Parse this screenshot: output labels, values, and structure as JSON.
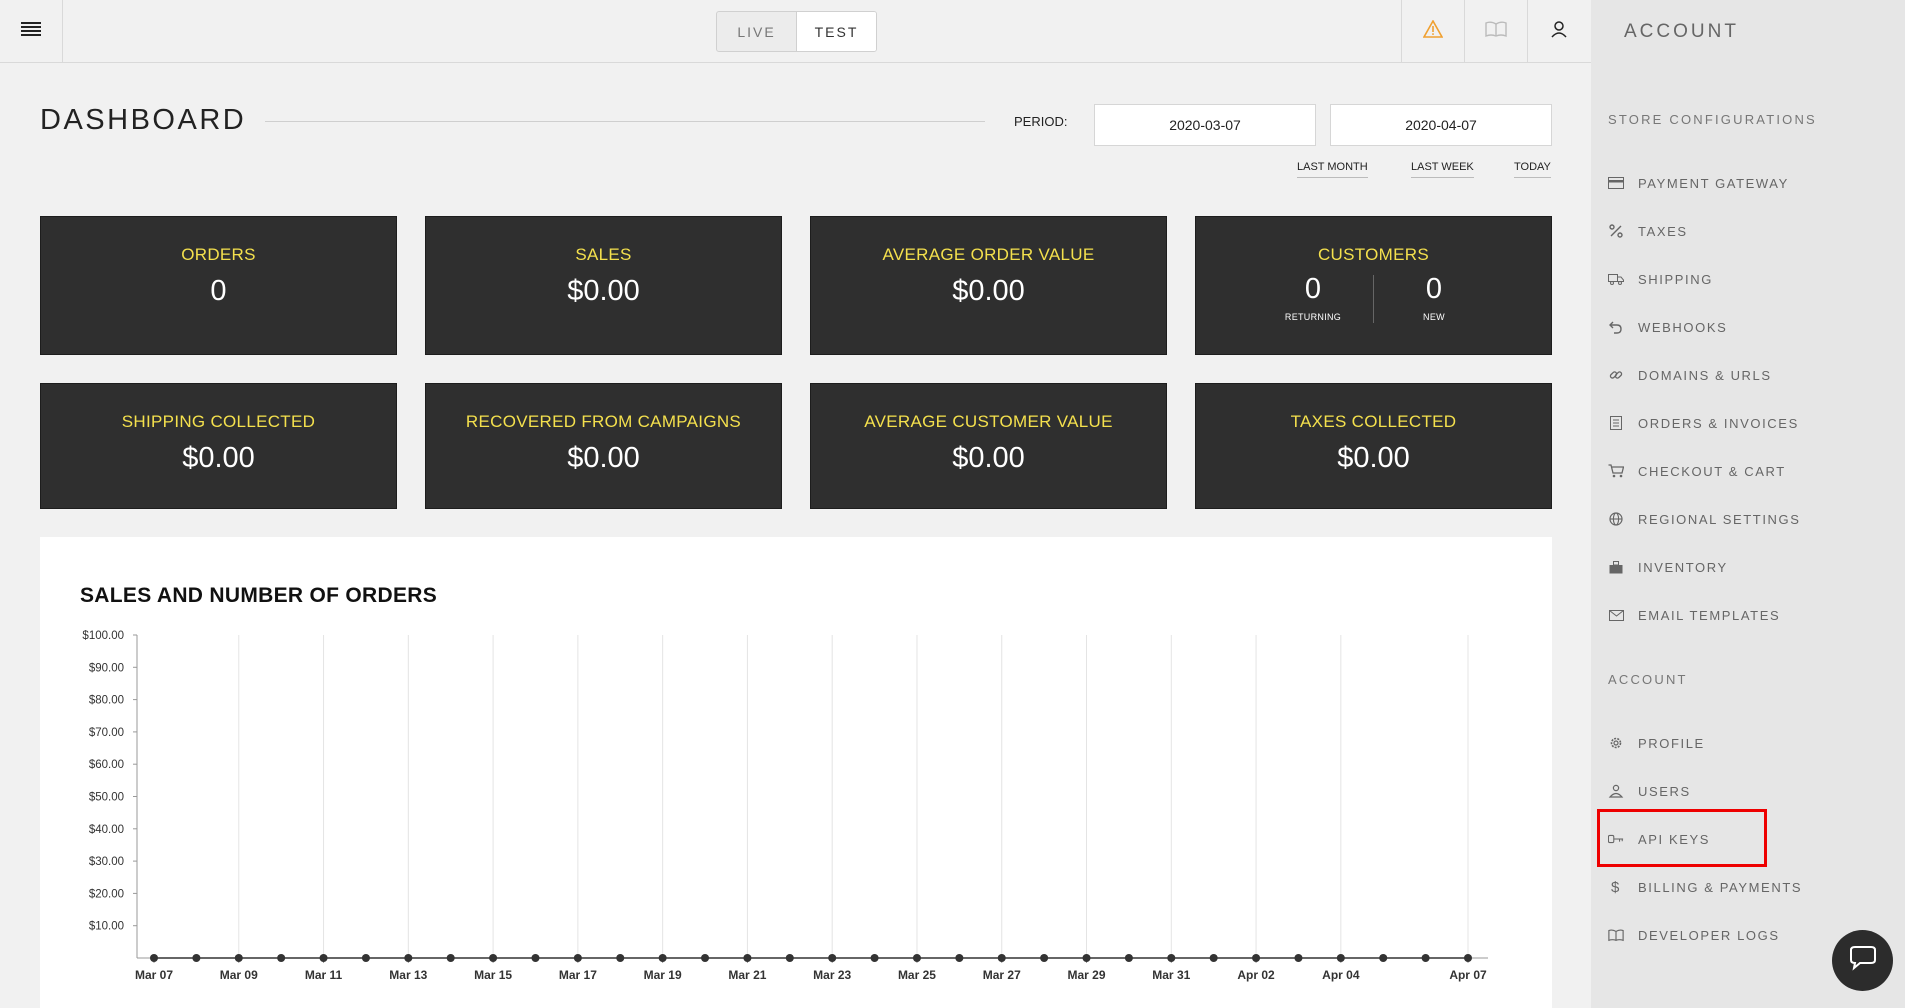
{
  "topbar": {
    "mode_live": "LIVE",
    "mode_test": "TEST",
    "active_mode": "TEST",
    "icons": [
      "menu-icon",
      "warning-icon",
      "book-icon",
      "user-icon"
    ]
  },
  "sidebar": {
    "title": "ACCOUNT",
    "store_section": "STORE CONFIGURATIONS",
    "store_items": [
      {
        "label": "PAYMENT GATEWAY",
        "icon": "credit-card-icon"
      },
      {
        "label": "TAXES",
        "icon": "percent-icon"
      },
      {
        "label": "SHIPPING",
        "icon": "truck-icon"
      },
      {
        "label": "WEBHOOKS",
        "icon": "webhook-icon"
      },
      {
        "label": "DOMAINS & URLS",
        "icon": "link-icon"
      },
      {
        "label": "ORDERS & INVOICES",
        "icon": "invoice-icon"
      },
      {
        "label": "CHECKOUT & CART",
        "icon": "cart-icon"
      },
      {
        "label": "REGIONAL SETTINGS",
        "icon": "globe-icon"
      },
      {
        "label": "INVENTORY",
        "icon": "box-icon"
      },
      {
        "label": "EMAIL TEMPLATES",
        "icon": "envelope-icon"
      }
    ],
    "account_section": "ACCOUNT",
    "account_items": [
      {
        "label": "PROFILE",
        "icon": "gear-icon"
      },
      {
        "label": "USERS",
        "icon": "users-icon"
      },
      {
        "label": "API KEYS",
        "icon": "key-icon"
      },
      {
        "label": "BILLING & PAYMENTS",
        "icon": "dollar-icon"
      },
      {
        "label": "DEVELOPER LOGS",
        "icon": "book-icon"
      }
    ],
    "highlighted_item": "API KEYS",
    "highlight_color": "#e00000"
  },
  "dashboard": {
    "title": "DASHBOARD",
    "period_label": "PERIOD:",
    "date_from": "2020-03-07",
    "date_to": "2020-04-07",
    "quick_links": [
      "LAST MONTH",
      "LAST WEEK",
      "TODAY"
    ]
  },
  "stats": {
    "orders": {
      "label": "ORDERS",
      "value": "0"
    },
    "sales": {
      "label": "SALES",
      "value": "$0.00"
    },
    "avg_order": {
      "label": "AVERAGE ORDER VALUE",
      "value": "$0.00"
    },
    "customers": {
      "label": "CUSTOMERS",
      "returning": "0",
      "returning_label": "RETURNING",
      "new": "0",
      "new_label": "NEW"
    },
    "shipping": {
      "label": "SHIPPING COLLECTED",
      "value": "$0.00"
    },
    "recovered": {
      "label": "RECOVERED FROM CAMPAIGNS",
      "value": "$0.00"
    },
    "avg_customer": {
      "label": "AVERAGE CUSTOMER VALUE",
      "value": "$0.00"
    },
    "taxes": {
      "label": "TAXES COLLECTED",
      "value": "$0.00"
    }
  },
  "colors": {
    "card_bg": "#2f2f2f",
    "card_label": "#f4e04d",
    "accent_warning": "#f0a030"
  },
  "chart": {
    "title": "SALES AND NUMBER OF ORDERS"
  },
  "chart_data": {
    "type": "line",
    "title": "SALES AND NUMBER OF ORDERS",
    "y_ticks": [
      "$100.00",
      "$90.00",
      "$80.00",
      "$70.00",
      "$60.00",
      "$50.00",
      "$40.00",
      "$30.00",
      "$20.00",
      "$10.00"
    ],
    "ylim": [
      0,
      100
    ],
    "x_tick_labels": [
      "Mar 07",
      "Mar 09",
      "Mar 11",
      "Mar 13",
      "Mar 15",
      "Mar 17",
      "Mar 19",
      "Mar 21",
      "Mar 23",
      "Mar 25",
      "Mar 27",
      "Mar 29",
      "Mar 31",
      "Apr 02",
      "Apr 04",
      "Apr 07"
    ],
    "x": [
      "Mar 07",
      "Mar 08",
      "Mar 09",
      "Mar 10",
      "Mar 11",
      "Mar 12",
      "Mar 13",
      "Mar 14",
      "Mar 15",
      "Mar 16",
      "Mar 17",
      "Mar 18",
      "Mar 19",
      "Mar 20",
      "Mar 21",
      "Mar 22",
      "Mar 23",
      "Mar 24",
      "Mar 25",
      "Mar 26",
      "Mar 27",
      "Mar 28",
      "Mar 29",
      "Mar 30",
      "Mar 31",
      "Apr 01",
      "Apr 02",
      "Apr 03",
      "Apr 04",
      "Apr 05",
      "Apr 06",
      "Apr 07"
    ],
    "series": [
      {
        "values": [
          0,
          0,
          0,
          0,
          0,
          0,
          0,
          0,
          0,
          0,
          0,
          0,
          0,
          0,
          0,
          0,
          0,
          0,
          0,
          0,
          0,
          0,
          0,
          0,
          0,
          0,
          0,
          0,
          0,
          0,
          0,
          0
        ]
      }
    ],
    "grid": true
  }
}
